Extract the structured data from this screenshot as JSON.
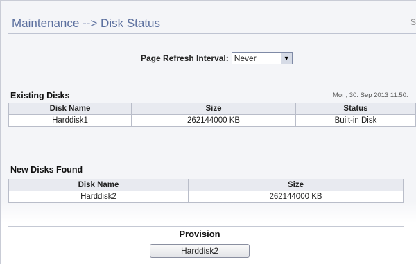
{
  "header": {
    "title": "Maintenance --> Disk Status",
    "title_tail": "S"
  },
  "refresh": {
    "label": "Page Refresh Interval:",
    "selected": "Never"
  },
  "existing_disks": {
    "heading": "Existing Disks",
    "timestamp": "Mon, 30. Sep 2013 11:50:",
    "columns": [
      "Disk Name",
      "Size",
      "Status"
    ],
    "rows": [
      [
        "Harddisk1",
        "262144000 KB",
        "Built-in Disk"
      ]
    ]
  },
  "new_disks": {
    "heading": "New Disks Found",
    "columns": [
      "Disk Name",
      "Size"
    ],
    "rows": [
      [
        "Harddisk2",
        "262144000 KB"
      ]
    ]
  },
  "provision": {
    "label": "Provision",
    "button_label": "Harddisk2"
  },
  "icons": {
    "select_arrow": "chevron-down-icon"
  }
}
